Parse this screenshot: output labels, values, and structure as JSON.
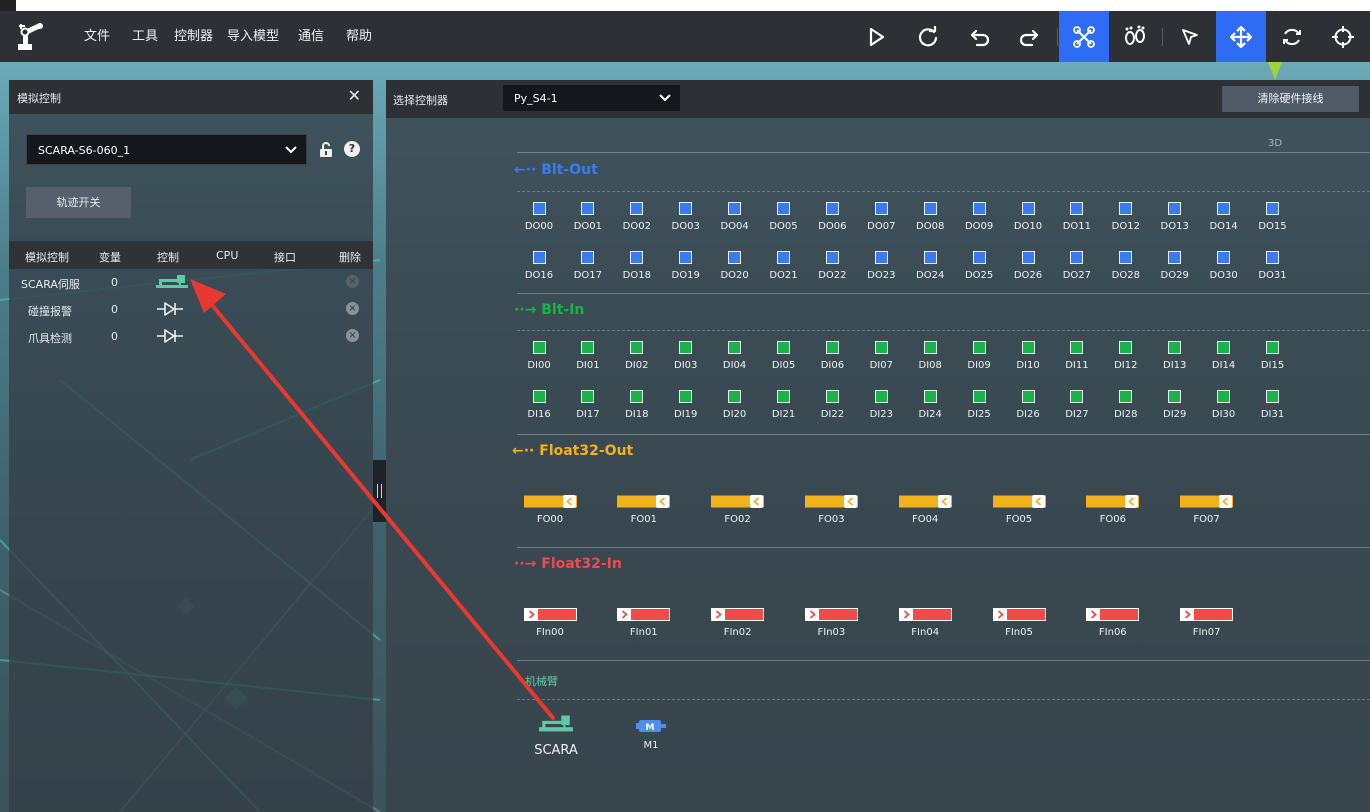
{
  "menubar": {
    "items": [
      "文件",
      "工具",
      "控制器",
      "导入模型",
      "通信",
      "帮助"
    ]
  },
  "toolbar": {
    "buttons": [
      {
        "icon": "play-icon",
        "active": false
      },
      {
        "icon": "redo-circle-icon",
        "active": false
      },
      {
        "icon": "undo-icon",
        "active": false
      },
      {
        "icon": "redo-icon",
        "active": false
      },
      {
        "icon": "drone-icon",
        "active": true
      },
      {
        "icon": "footprints-icon",
        "active": false
      },
      {
        "icon": "pointer-icon",
        "active": false
      },
      {
        "icon": "move-icon",
        "active": true
      },
      {
        "icon": "rotate-icon",
        "active": false
      },
      {
        "icon": "crosshair-icon",
        "active": false
      }
    ]
  },
  "left_panel": {
    "title": "模拟控制",
    "robot_select": "SCARA-S6-060_1",
    "trace_button": "轨迹开关",
    "table": {
      "headers": [
        "模拟控制",
        "变量",
        "控制",
        "CPU",
        "接口",
        "删除"
      ],
      "rows": [
        {
          "name": "SCARA伺服",
          "value": "0",
          "control_icon": "scara-robot-icon"
        },
        {
          "name": "碰撞报警",
          "value": "0",
          "control_icon": "diode-icon"
        },
        {
          "name": "爪具检测",
          "value": "0",
          "control_icon": "diode-icon"
        }
      ]
    }
  },
  "right_panel": {
    "label": "选择控制器",
    "controller_select": "Py_S4-1",
    "clear_button": "清除硬件接线",
    "view_label": "3D",
    "sections": {
      "blt_out": {
        "title": "Blt-Out",
        "color": "#3b7bf2"
      },
      "blt_in": {
        "title": "Blt-In",
        "color": "#19b34a"
      },
      "float_out": {
        "title": "Float32-Out",
        "color": "#f2b21c"
      },
      "float_in": {
        "title": "Float32-In",
        "color": "#ee4b4b"
      },
      "arm": {
        "title": "机械臂"
      }
    },
    "do_ports": [
      "DO00",
      "DO01",
      "DO02",
      "DO03",
      "DO04",
      "DO05",
      "DO06",
      "DO07",
      "DO08",
      "DO09",
      "DO10",
      "DO11",
      "DO12",
      "DO13",
      "DO14",
      "DO15",
      "DO16",
      "DO17",
      "DO18",
      "DO19",
      "DO20",
      "DO21",
      "DO22",
      "DO23",
      "DO24",
      "DO25",
      "DO26",
      "DO27",
      "DO28",
      "DO29",
      "DO30",
      "DO31"
    ],
    "di_ports": [
      "DI00",
      "DI01",
      "DI02",
      "DI03",
      "DI04",
      "DI05",
      "DI06",
      "DI07",
      "DI08",
      "DI09",
      "DI10",
      "DI11",
      "DI12",
      "DI13",
      "DI14",
      "DI15",
      "DI16",
      "DI17",
      "DI18",
      "DI19",
      "DI20",
      "DI21",
      "DI22",
      "DI23",
      "DI24",
      "DI25",
      "DI26",
      "DI27",
      "DI28",
      "DI29",
      "DI30",
      "DI31"
    ],
    "fo_ports": [
      "FO00",
      "FO01",
      "FO02",
      "FO03",
      "FO04",
      "FO05",
      "FO06",
      "FO07"
    ],
    "fi_ports": [
      "FIn00",
      "FIn01",
      "FIn02",
      "FIn03",
      "FIn04",
      "FIn05",
      "FIn06",
      "FIn07"
    ],
    "arm_items": [
      {
        "label": "SCARA",
        "icon": "scara-robot-icon"
      },
      {
        "label": "M1",
        "icon": "motor-icon"
      }
    ]
  },
  "colors": {
    "accent_active": "#2f6cf6",
    "out_blue": "#3b7bf2",
    "in_green": "#19b34a",
    "float_yellow": "#f2b21c",
    "float_red": "#ee4b4b",
    "annotation_arrow": "#e8382f"
  }
}
